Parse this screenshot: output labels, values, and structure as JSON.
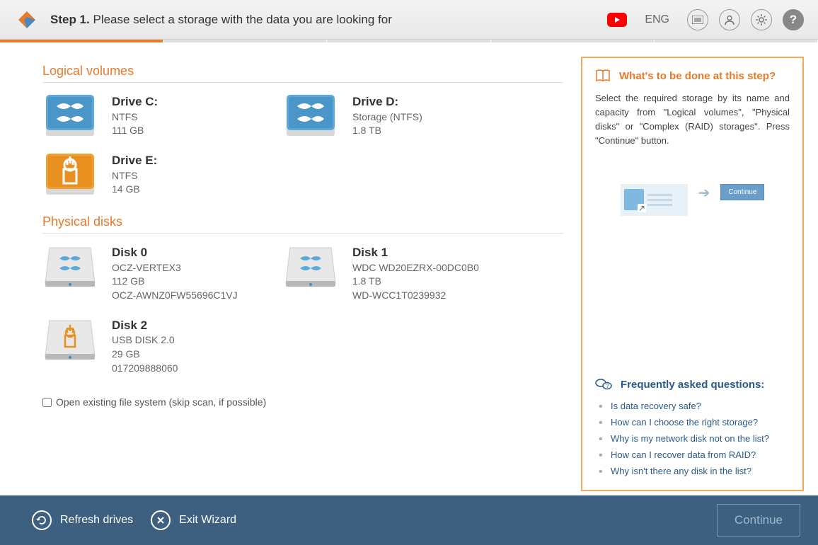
{
  "header": {
    "step_label": "Step 1.",
    "title": "Please select a storage with the data you are looking for",
    "lang": "ENG"
  },
  "sections": {
    "logical": "Logical volumes",
    "physical": "Physical disks"
  },
  "logical": [
    {
      "name": "Drive C:",
      "fs": "NTFS",
      "size": "111 GB",
      "type": "win-blue"
    },
    {
      "name": "Drive D:",
      "fs": "Storage (NTFS)",
      "size": "1.8 TB",
      "type": "win-blue"
    },
    {
      "name": "Drive E:",
      "fs": "NTFS",
      "size": "14 GB",
      "type": "usb-orange"
    }
  ],
  "physical": [
    {
      "name": "Disk 0",
      "model": "OCZ-VERTEX3",
      "size": "112 GB",
      "serial": "OCZ-AWNZ0FW55696C1VJ",
      "type": "hdd-win"
    },
    {
      "name": "Disk 1",
      "model": "WDC WD20EZRX-00DC0B0",
      "size": "1.8 TB",
      "serial": "WD-WCC1T0239932",
      "type": "hdd-win"
    },
    {
      "name": "Disk 2",
      "model": "USB DISK 2.0",
      "size": "29 GB",
      "serial": "017209888060",
      "type": "hdd-usb"
    }
  ],
  "checkbox": "Open existing file system (skip scan, if possible)",
  "side": {
    "title": "What's to be done at this step?",
    "text": "Select the required storage by its name and capacity from \"Logical volumes\", \"Physical disks\" or \"Complex (RAID) storages\". Press \"Continue\" button.",
    "diagram_btn": "Continue",
    "faq_title": "Frequently asked questions:",
    "faq": [
      "Is data recovery safe?",
      "How can I choose the right storage?",
      "Why is my network disk not on the list?",
      "How can I recover data from RAID?",
      "Why isn't there any disk in the list?"
    ]
  },
  "footer": {
    "refresh": "Refresh drives",
    "exit": "Exit Wizard",
    "continue": "Continue"
  }
}
